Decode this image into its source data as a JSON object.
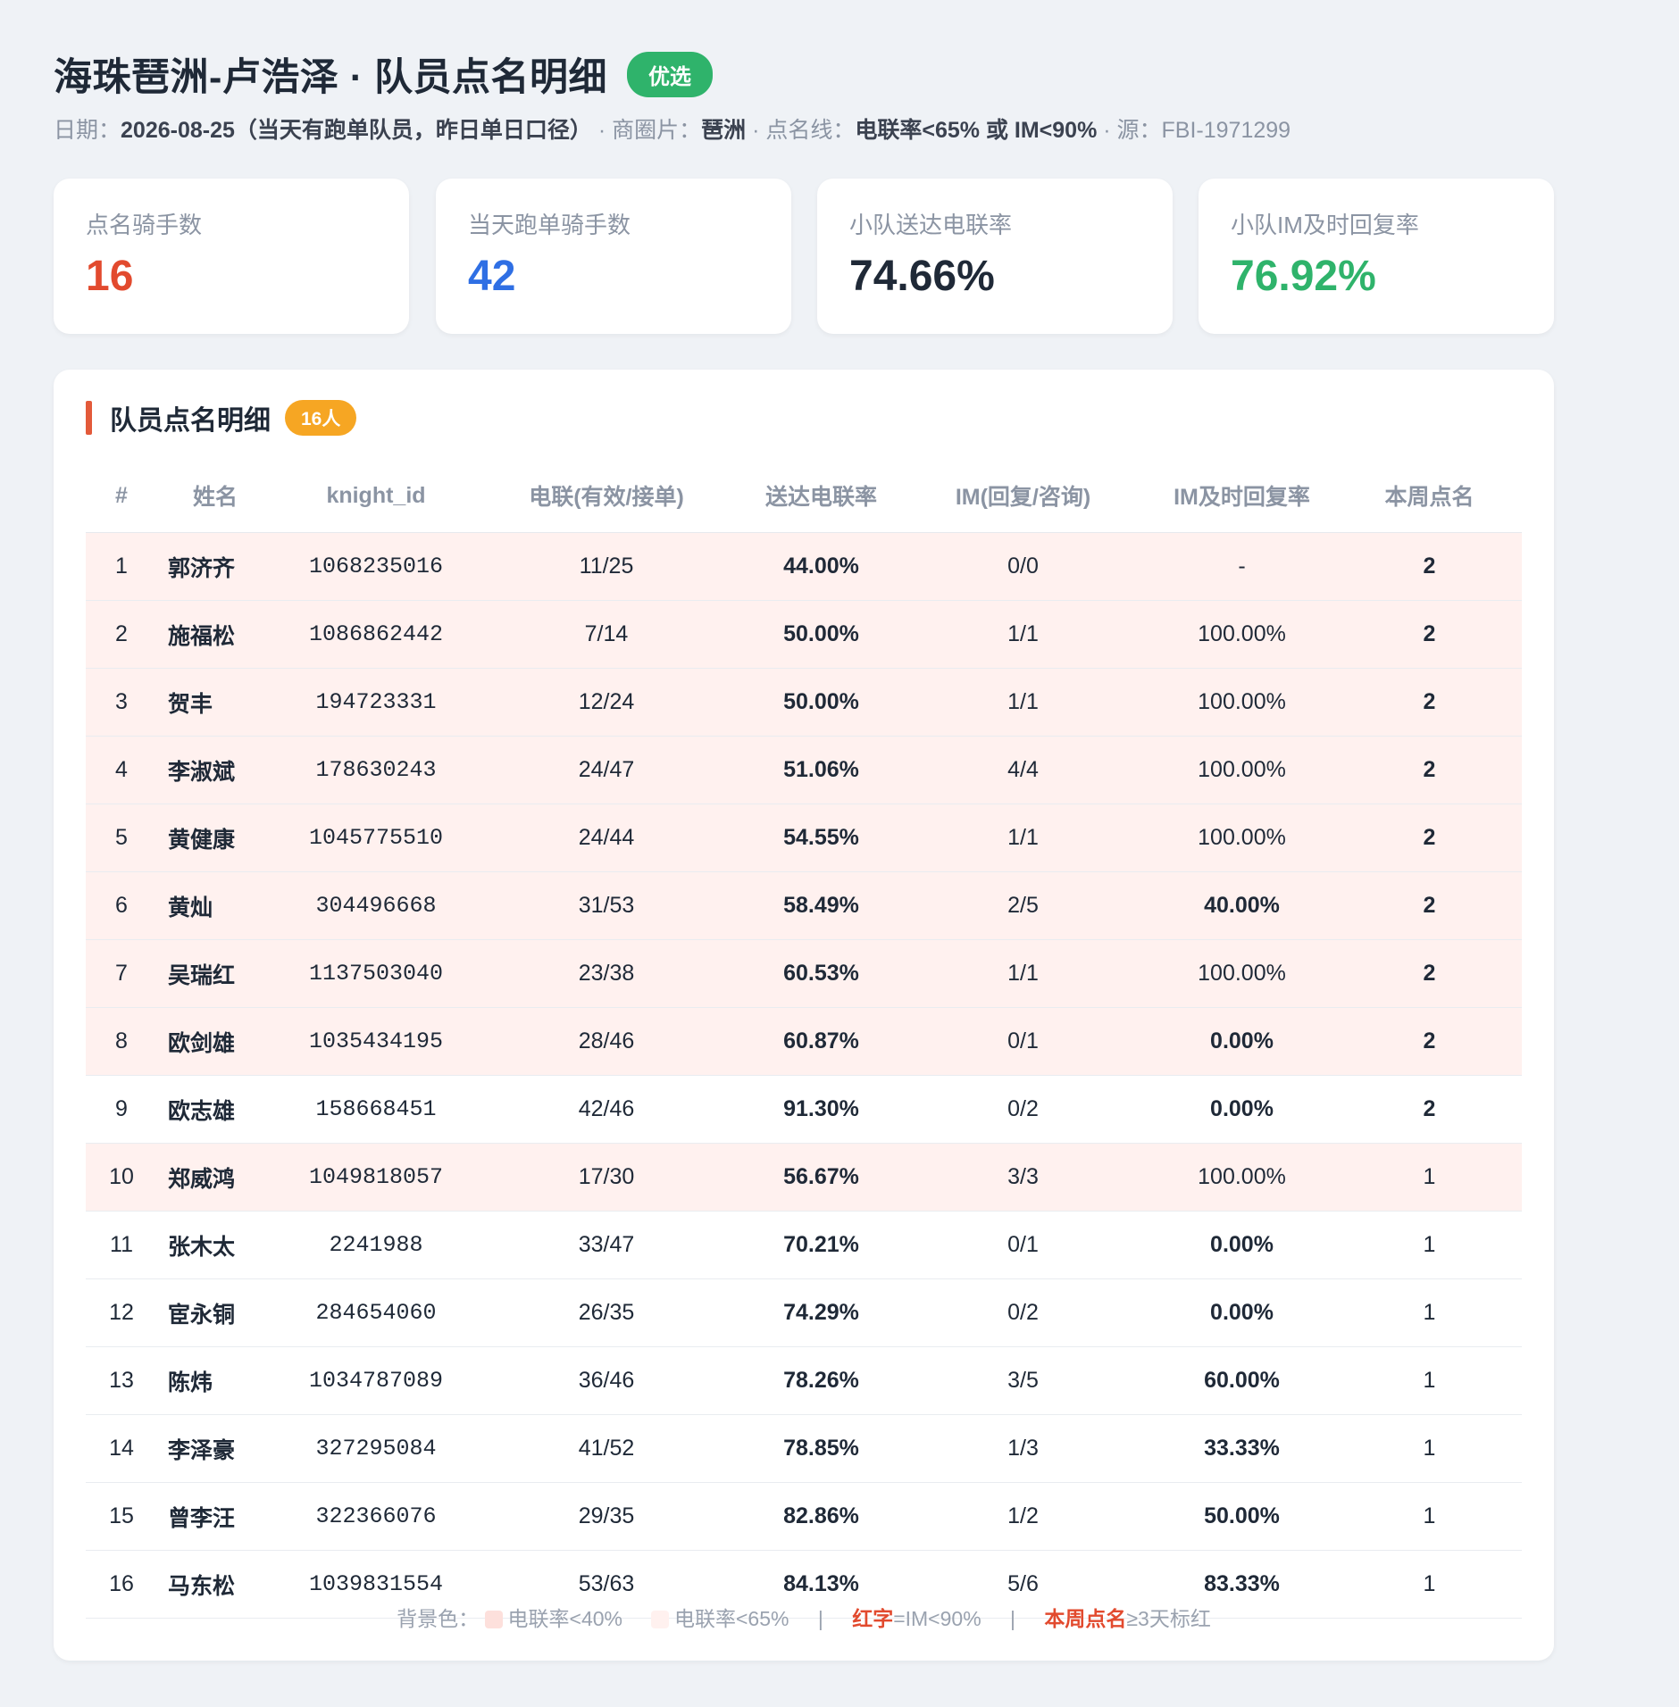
{
  "header": {
    "title": "海珠琶洲-卢浩泽 · 队员点名明细",
    "badge": "优选",
    "date_label": "日期：",
    "date_value": "2026-08-25（当天有跑单队员，昨日单日口径）",
    "area_label": " · 商圈片：",
    "area_value": "琶洲",
    "line_label": " · 点名线：",
    "line_value": "电联率<65% 或 IM<90%",
    "source_text": " · 源：FBI-1971299"
  },
  "stats": [
    {
      "label": "点名骑手数",
      "value": "16",
      "color": "#e24a2e"
    },
    {
      "label": "当天跑单骑手数",
      "value": "42",
      "color": "#2f6fe4"
    },
    {
      "label": "小队送达电联率",
      "value": "74.66%",
      "color": "#1f2937"
    },
    {
      "label": "小队IM及时回复率",
      "value": "76.92%",
      "color": "#2fb36b"
    }
  ],
  "panel": {
    "title": "队员点名明细",
    "count_badge": "16人"
  },
  "table": {
    "columns": [
      "#",
      "姓名",
      "knight_id",
      "电联(有效/接单)",
      "送达电联率",
      "IM(回复/咨询)",
      "IM及时回复率",
      "本周点名"
    ],
    "rows": [
      {
        "n": "1",
        "name": "郭济齐",
        "kid": "1068235016",
        "call": "11/25",
        "rate": "44.00%",
        "im": "0/0",
        "im_rate": "-",
        "week": "2"
      },
      {
        "n": "2",
        "name": "施福松",
        "kid": "1086862442",
        "call": "7/14",
        "rate": "50.00%",
        "im": "1/1",
        "im_rate": "100.00%",
        "week": "2"
      },
      {
        "n": "3",
        "name": "贺丰",
        "kid": "194723331",
        "call": "12/24",
        "rate": "50.00%",
        "im": "1/1",
        "im_rate": "100.00%",
        "week": "2"
      },
      {
        "n": "4",
        "name": "李淑斌",
        "kid": "178630243",
        "call": "24/47",
        "rate": "51.06%",
        "im": "4/4",
        "im_rate": "100.00%",
        "week": "2"
      },
      {
        "n": "5",
        "name": "黄健康",
        "kid": "1045775510",
        "call": "24/44",
        "rate": "54.55%",
        "im": "1/1",
        "im_rate": "100.00%",
        "week": "2"
      },
      {
        "n": "6",
        "name": "黄灿",
        "kid": "304496668",
        "call": "31/53",
        "rate": "58.49%",
        "im": "2/5",
        "im_rate": "40.00%",
        "week": "2"
      },
      {
        "n": "7",
        "name": "吴瑞红",
        "kid": "1137503040",
        "call": "23/38",
        "rate": "60.53%",
        "im": "1/1",
        "im_rate": "100.00%",
        "week": "2"
      },
      {
        "n": "8",
        "name": "欧剑雄",
        "kid": "1035434195",
        "call": "28/46",
        "rate": "60.87%",
        "im": "0/1",
        "im_rate": "0.00%",
        "week": "2"
      },
      {
        "n": "9",
        "name": "欧志雄",
        "kid": "158668451",
        "call": "42/46",
        "rate": "91.30%",
        "im": "0/2",
        "im_rate": "0.00%",
        "week": "2"
      },
      {
        "n": "10",
        "name": "郑威鸿",
        "kid": "1049818057",
        "call": "17/30",
        "rate": "56.67%",
        "im": "3/3",
        "im_rate": "100.00%",
        "week": "1"
      },
      {
        "n": "11",
        "name": "张木太",
        "kid": "2241988",
        "call": "33/47",
        "rate": "70.21%",
        "im": "0/1",
        "im_rate": "0.00%",
        "week": "1"
      },
      {
        "n": "12",
        "name": "宦永铜",
        "kid": "284654060",
        "call": "26/35",
        "rate": "74.29%",
        "im": "0/2",
        "im_rate": "0.00%",
        "week": "1"
      },
      {
        "n": "13",
        "name": "陈炜",
        "kid": "1034787089",
        "call": "36/46",
        "rate": "78.26%",
        "im": "3/5",
        "im_rate": "60.00%",
        "week": "1"
      },
      {
        "n": "14",
        "name": "李泽豪",
        "kid": "327295084",
        "call": "41/52",
        "rate": "78.85%",
        "im": "1/3",
        "im_rate": "33.33%",
        "week": "1"
      },
      {
        "n": "15",
        "name": "曾李汪",
        "kid": "322366076",
        "call": "29/35",
        "rate": "82.86%",
        "im": "1/2",
        "im_rate": "50.00%",
        "week": "1"
      },
      {
        "n": "16",
        "name": "马东松",
        "kid": "1039831554",
        "call": "53/63",
        "rate": "84.13%",
        "im": "5/6",
        "im_rate": "83.33%",
        "week": "1"
      }
    ]
  },
  "legend": {
    "prefix": "背景色：",
    "item1": "电联率<40%",
    "item2": "电联率<65%",
    "sep": "|",
    "red_word": "红字",
    "red_desc": "=IM<90%",
    "week_word": "本周点名",
    "week_desc": "≥3天标红",
    "swatch1_color": "#fde0dc",
    "swatch2_color": "#fff1ef"
  },
  "colors": {
    "row_highlight": "#fff1ef",
    "red": "#e24a2e",
    "orange": "#f6a623",
    "green": "#2fb36b"
  }
}
